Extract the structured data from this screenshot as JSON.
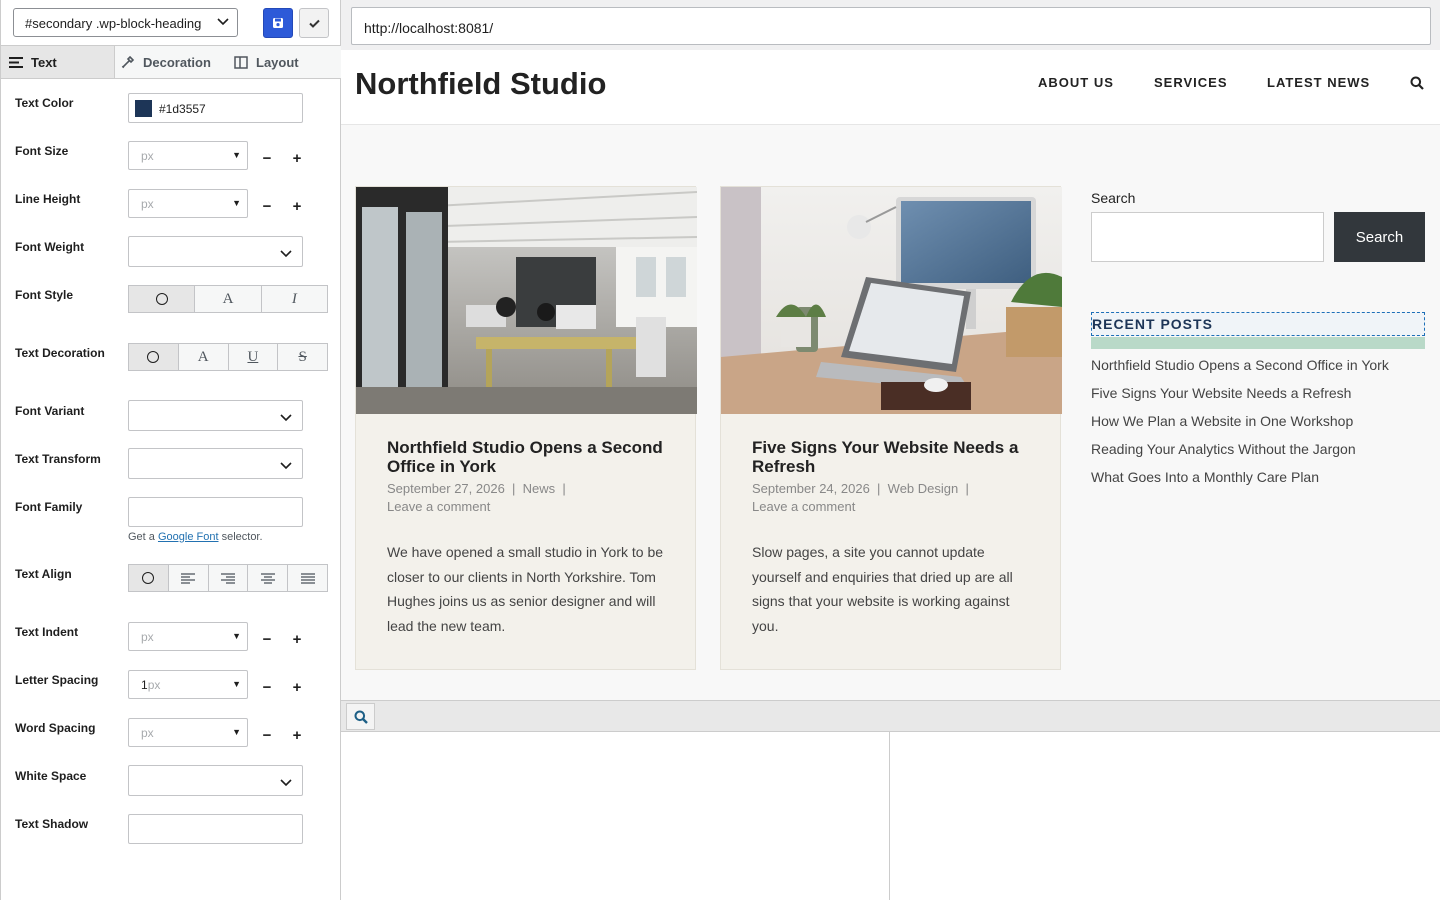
{
  "panel": {
    "selector": "#secondary .wp-block-heading",
    "tabs": {
      "text": "Text",
      "decoration": "Decoration",
      "layout": "Layout"
    },
    "labels": {
      "text_color": "Text Color",
      "font_size": "Font Size",
      "line_height": "Line Height",
      "font_weight": "Font Weight",
      "font_style": "Font Style",
      "text_decoration": "Text Decoration",
      "font_variant": "Font Variant",
      "text_transform": "Text Transform",
      "font_family": "Font Family",
      "text_align": "Text Align",
      "text_indent": "Text Indent",
      "letter_spacing": "Letter Spacing",
      "word_spacing": "Word Spacing",
      "white_space": "White Space",
      "text_shadow": "Text Shadow"
    },
    "text_color_value": "#1d3557",
    "text_color_swatch": "#1d3557",
    "unit": "px",
    "letter_spacing_value": "1",
    "minus": "−",
    "plus": "+",
    "font_style_opts": [
      "A",
      "I"
    ],
    "decoration_opts": [
      "A",
      "U",
      "S"
    ],
    "gf_pre": "Get a",
    "gf_link": "Google Font",
    "gf_post": "selector."
  },
  "browser": {
    "url": "http://localhost:8081/"
  },
  "site": {
    "title": "Northfield Studio",
    "nav": [
      "ABOUT US",
      "SERVICES",
      "LATEST NEWS"
    ],
    "posts": [
      {
        "title": "Northfield Studio Opens a Second Office in York",
        "date": "September 27, 2026",
        "category": "News",
        "comments": "Leave a comment",
        "excerpt": "We have opened a small studio in York to be closer to our clients in North Yorkshire. Tom Hughes joins us as senior designer and will lead the new team."
      },
      {
        "title": "Five Signs Your Website Needs a Refresh",
        "date": "September 24, 2026",
        "category": "Web Design",
        "comments": "Leave a comment",
        "excerpt": "Slow pages, a site you cannot update yourself and enquiries that dried up are all signs that your website is working against you."
      }
    ],
    "sidebar": {
      "search_label": "Search",
      "search_button": "Search",
      "recent_heading": "RECENT POSTS",
      "recent_posts": [
        "Northfield Studio Opens a Second Office in York",
        "Five Signs Your Website Needs a Refresh",
        "How We Plan a Website in One Workshop",
        "Reading Your Analytics Without the Jargon",
        "What Goes Into a Monthly Care Plan"
      ]
    }
  },
  "colors": {
    "save_button": "#2d5ad8",
    "heading_highlight": "#b9d9c8",
    "card_bg": "#f3f1eb",
    "search_button": "#32373c"
  }
}
